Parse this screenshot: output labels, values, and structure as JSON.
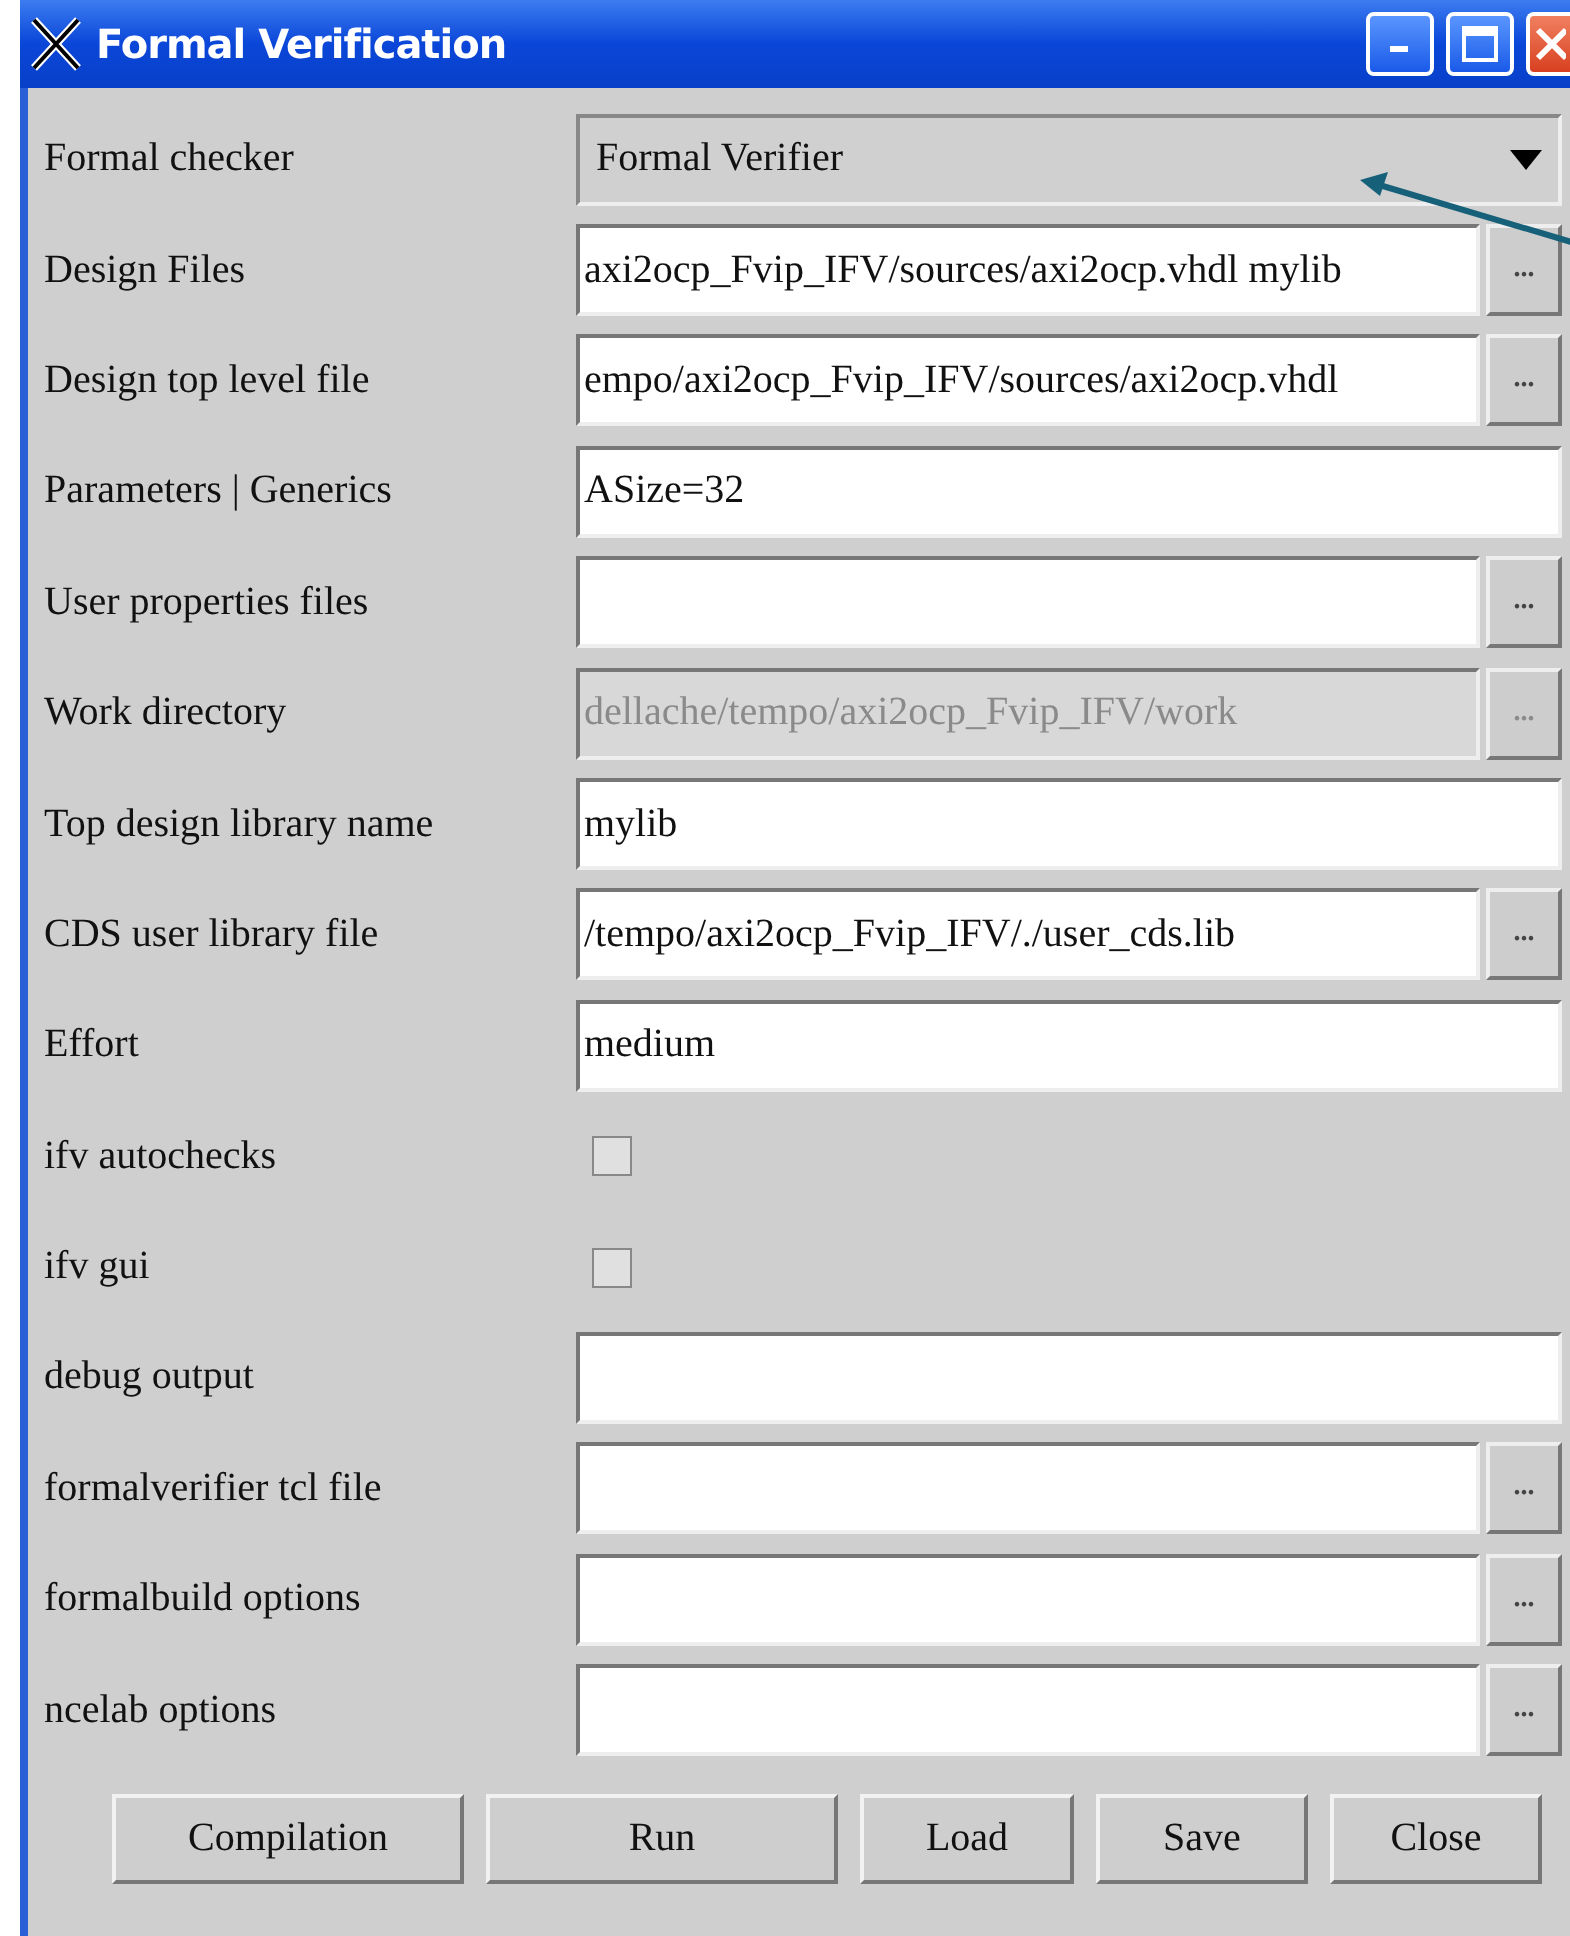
{
  "window": {
    "title": "Formal Verification"
  },
  "fields": [
    {
      "label": "Formal checker",
      "kind": "dropdown",
      "value": "Formal Verifier"
    },
    {
      "label": "Design Files",
      "kind": "text",
      "value": "axi2ocp_Fvip_IFV/sources/axi2ocp.vhdl mylib",
      "browse": "...",
      "disabled": false
    },
    {
      "label": "Design top level file",
      "kind": "text",
      "value": "empo/axi2ocp_Fvip_IFV/sources/axi2ocp.vhdl",
      "browse": "...",
      "disabled": false
    },
    {
      "label": "Parameters | Generics",
      "kind": "text",
      "value": "ASize=32",
      "disabled": false
    },
    {
      "label": "User properties files",
      "kind": "text",
      "browse": "...",
      "disabled": false
    },
    {
      "label": "Work directory",
      "kind": "text",
      "value": "dellache/tempo/axi2ocp_Fvip_IFV/work",
      "browse": "...",
      "disabled": true
    },
    {
      "label": "Top design library name",
      "kind": "text",
      "value": "mylib",
      "disabled": false
    },
    {
      "label": "CDS user library file",
      "kind": "text",
      "value": "/tempo/axi2ocp_Fvip_IFV/./user_cds.lib",
      "browse": "...",
      "disabled": false
    },
    {
      "label": "Effort",
      "kind": "text",
      "value": "medium",
      "disabled": false
    },
    {
      "label": "ifv autochecks",
      "kind": "checkbox",
      "checked": false
    },
    {
      "label": "ifv gui",
      "kind": "checkbox",
      "checked": false
    },
    {
      "label": "debug output",
      "kind": "text",
      "disabled": false
    },
    {
      "label": "formalverifier tcl file",
      "kind": "text",
      "browse": "...",
      "disabled": false
    },
    {
      "label": "formalbuild options",
      "kind": "text",
      "browse": "...",
      "disabled": false
    },
    {
      "label": "ncelab options",
      "kind": "text",
      "browse": "...",
      "disabled": false
    }
  ],
  "buttons": [
    "Compilation",
    "Run",
    "Load",
    "Save",
    "Close"
  ]
}
